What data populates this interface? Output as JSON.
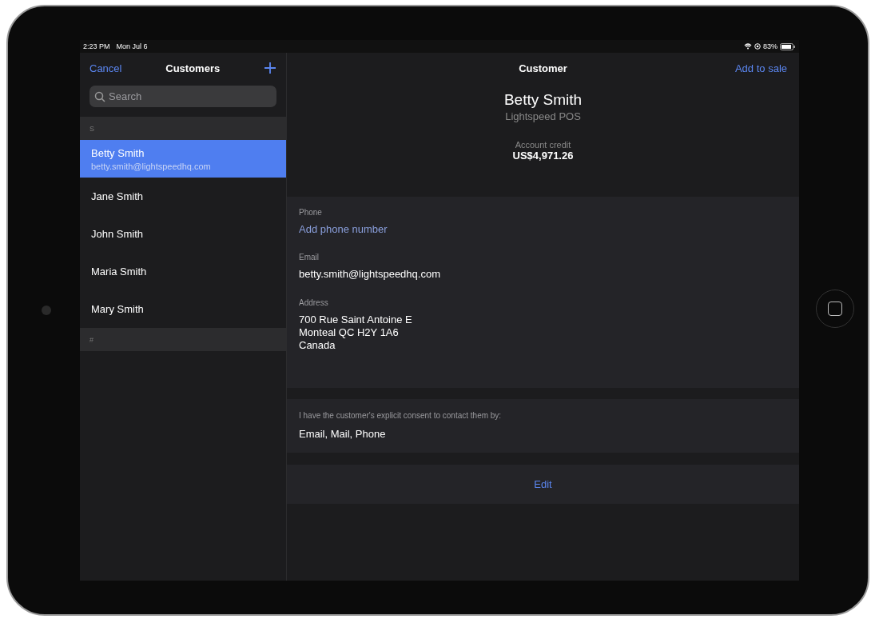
{
  "status_bar": {
    "time": "2:23 PM",
    "date": "Mon Jul 6",
    "battery": "83%"
  },
  "sidebar": {
    "cancel": "Cancel",
    "title": "Customers",
    "search": {
      "placeholder": "Search"
    },
    "sections": [
      {
        "header": "S",
        "items": [
          {
            "name": "Betty Smith",
            "email": "betty.smith@lightspeedhq.com",
            "selected": true
          },
          {
            "name": "Jane Smith",
            "selected": false
          },
          {
            "name": "John Smith",
            "selected": false
          },
          {
            "name": "Maria Smith",
            "selected": false
          },
          {
            "name": "Mary Smith",
            "selected": false
          }
        ]
      },
      {
        "header": "#"
      }
    ]
  },
  "detail": {
    "title": "Customer",
    "action": "Add to sale",
    "name": "Betty Smith",
    "company": "Lightspeed POS",
    "credit_label": "Account credit",
    "credit_value": "US$4,971.26",
    "fields": [
      {
        "label": "Phone",
        "kind": "link",
        "lines": [
          "Add phone number"
        ]
      },
      {
        "label": "Email",
        "kind": "text",
        "lines": [
          "betty.smith@lightspeedhq.com"
        ]
      },
      {
        "label": "Address",
        "kind": "text",
        "lines": [
          "700 Rue Saint Antoine E",
          "Monteal QC H2Y 1A6",
          "Canada"
        ]
      }
    ],
    "consent": {
      "label": "I have the customer's explicit consent to contact them by:",
      "value": "Email, Mail, Phone"
    },
    "edit": "Edit"
  }
}
